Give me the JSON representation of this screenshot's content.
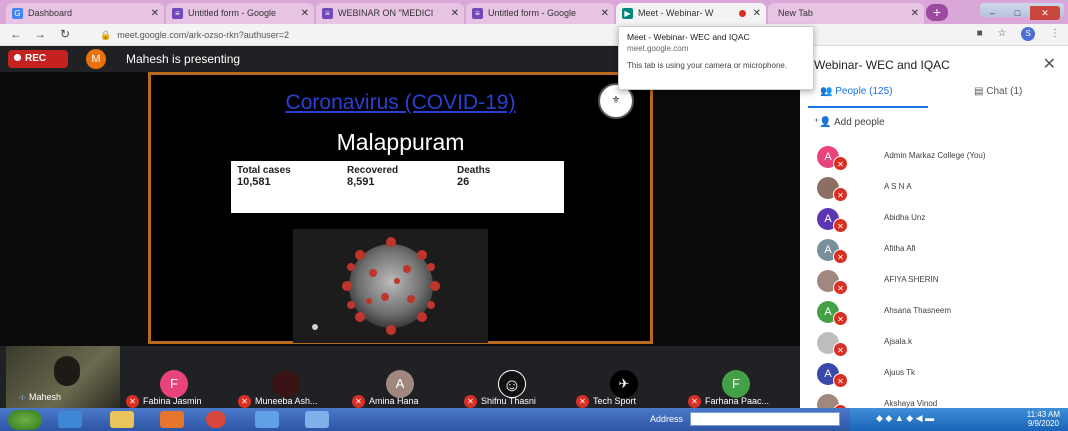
{
  "browser": {
    "tabs": [
      {
        "label": "Dashboard",
        "icon": "google-icon",
        "icon_color": "#4285f4",
        "active": false
      },
      {
        "label": "Untitled form - Google",
        "icon": "forms-icon",
        "icon_color": "#7248b9",
        "active": false
      },
      {
        "label": "WEBINAR ON \"MEDICI",
        "icon": "forms-icon",
        "icon_color": "#7248b9",
        "active": false
      },
      {
        "label": "Untitled form - Google",
        "icon": "forms-icon",
        "icon_color": "#7248b9",
        "active": false
      },
      {
        "label": "Meet - Webinar- W",
        "icon": "meet-icon",
        "icon_color": "#00897b",
        "active": true
      },
      {
        "label": "New Tab",
        "icon": "",
        "icon_color": "",
        "active": false
      }
    ],
    "url": "meet.google.com/ark-ozso-rkn?authuser=2",
    "profile_initial": "S"
  },
  "tooltip": {
    "title": "Meet - Webinar- WEC and IQAC",
    "host": "meet.google.com",
    "note": "This tab is using your camera or microphone."
  },
  "meet": {
    "rec_label": "REC",
    "presenter_initial": "M",
    "presenting_text": "Mahesh is presenting"
  },
  "slide": {
    "title": "Coronavirus (COVID-19)",
    "place": "Malappuram",
    "stats": [
      {
        "label": "Total cases",
        "value": "10,581"
      },
      {
        "label": "Recovered",
        "value": "8,591"
      },
      {
        "label": "Deaths",
        "value": "26"
      }
    ]
  },
  "filmstrip": {
    "self_name": "Mahesh",
    "tiles": [
      {
        "initial": "F",
        "name": "Fabina Jasmin",
        "color": "#e8437b"
      },
      {
        "initial": "",
        "name": "Muneeba Ash...",
        "color": "#3a1414"
      },
      {
        "initial": "A",
        "name": "Amina Hana",
        "color": "#a1887f"
      },
      {
        "initial": "☺",
        "name": "Shifnu Thasni",
        "color": "#111111"
      },
      {
        "initial": "✈",
        "name": "Tech Sport",
        "color": "#000000"
      },
      {
        "initial": "F",
        "name": "Farhana Paac...",
        "color": "#43a047"
      }
    ]
  },
  "panel": {
    "title": "Webinar- WEC and IQAC",
    "people_tab": "People (125)",
    "chat_tab": "Chat (1)",
    "add_people": "Add people",
    "people": [
      {
        "initial": "A",
        "name": "Admin Markaz College (You)",
        "color": "#e8437b"
      },
      {
        "initial": "",
        "name": "A S N A",
        "color": "#8d6e63"
      },
      {
        "initial": "A",
        "name": "Abidha Unz",
        "color": "#5e35b1"
      },
      {
        "initial": "A",
        "name": "Afitha Afi",
        "color": "#78909c"
      },
      {
        "initial": "",
        "name": "AFIYA SHERIN",
        "color": "#a1887f"
      },
      {
        "initial": "A",
        "name": "Ahsana Thasneem",
        "color": "#43a047"
      },
      {
        "initial": "",
        "name": "Ajsala.k",
        "color": "#bdbdbd"
      },
      {
        "initial": "A",
        "name": "Ajuus Tk",
        "color": "#3949ab"
      },
      {
        "initial": "",
        "name": "Akshaya Vinod",
        "color": "#a1887f"
      }
    ]
  },
  "taskbar": {
    "address_label": "Address",
    "time": "11:43 AM",
    "date": "9/9/2020"
  }
}
